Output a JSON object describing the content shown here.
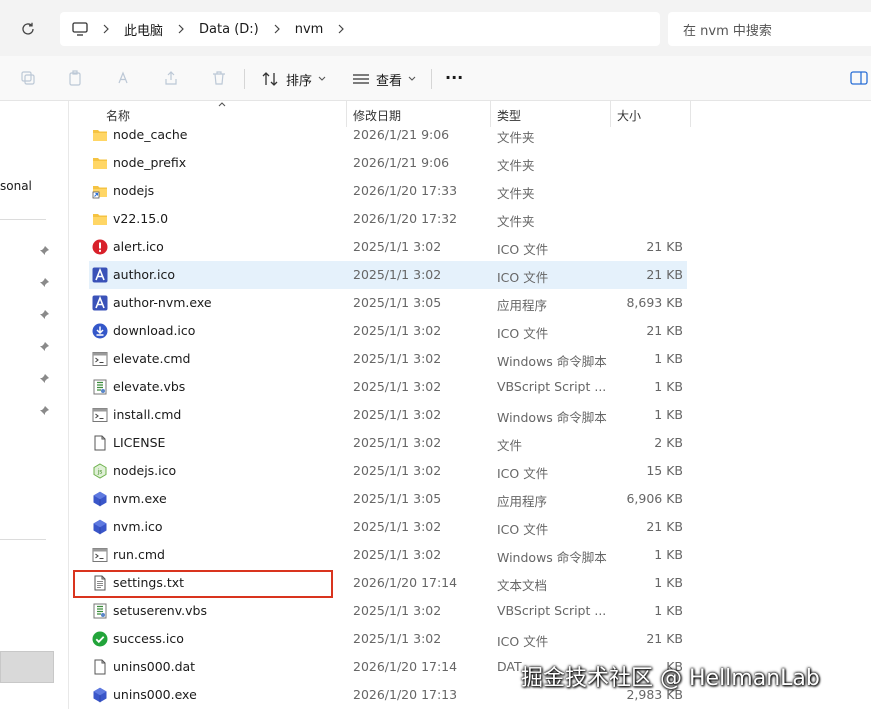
{
  "address": {
    "crumbs": [
      "此电脑",
      "Data (D:)",
      "nvm"
    ],
    "search_placeholder": "在 nvm 中搜索"
  },
  "toolbar": {
    "sort_label": "排序",
    "view_label": "查看",
    "more_label": "···"
  },
  "nav": {
    "partial_label": "sonal"
  },
  "columns": {
    "name": "名称",
    "date": "修改日期",
    "type": "类型",
    "size": "大小"
  },
  "files": [
    {
      "name": "node_cache",
      "date": "2026/1/21 9:06",
      "type": "文件夹",
      "size": "",
      "icon": "folder-icon"
    },
    {
      "name": "node_prefix",
      "date": "2026/1/21 9:06",
      "type": "文件夹",
      "size": "",
      "icon": "folder-icon"
    },
    {
      "name": "nodejs",
      "date": "2026/1/20 17:33",
      "type": "文件夹",
      "size": "",
      "icon": "folder-shortcut-icon"
    },
    {
      "name": "v22.15.0",
      "date": "2026/1/20 17:32",
      "type": "文件夹",
      "size": "",
      "icon": "folder-icon"
    },
    {
      "name": "alert.ico",
      "date": "2025/1/1 3:02",
      "type": "ICO 文件",
      "size": "21 KB",
      "icon": "alert-icon"
    },
    {
      "name": "author.ico",
      "date": "2025/1/1 3:02",
      "type": "ICO 文件",
      "size": "21 KB",
      "icon": "author-icon"
    },
    {
      "name": "author-nvm.exe",
      "date": "2025/1/1 3:05",
      "type": "应用程序",
      "size": "8,693 KB",
      "icon": "author-icon"
    },
    {
      "name": "download.ico",
      "date": "2025/1/1 3:02",
      "type": "ICO 文件",
      "size": "21 KB",
      "icon": "download-icon"
    },
    {
      "name": "elevate.cmd",
      "date": "2025/1/1 3:02",
      "type": "Windows 命令脚本",
      "size": "1 KB",
      "icon": "cmd-file-icon"
    },
    {
      "name": "elevate.vbs",
      "date": "2025/1/1 3:02",
      "type": "VBScript Script ...",
      "size": "1 KB",
      "icon": "vbs-file-icon"
    },
    {
      "name": "install.cmd",
      "date": "2025/1/1 3:02",
      "type": "Windows 命令脚本",
      "size": "1 KB",
      "icon": "cmd-file-icon"
    },
    {
      "name": "LICENSE",
      "date": "2025/1/1 3:02",
      "type": "文件",
      "size": "2 KB",
      "icon": "blank-file-icon"
    },
    {
      "name": "nodejs.ico",
      "date": "2025/1/1 3:02",
      "type": "ICO 文件",
      "size": "15 KB",
      "icon": "nodejs-icon"
    },
    {
      "name": "nvm.exe",
      "date": "2025/1/1 3:05",
      "type": "应用程序",
      "size": "6,906 KB",
      "icon": "nvm-icon"
    },
    {
      "name": "nvm.ico",
      "date": "2025/1/1 3:02",
      "type": "ICO 文件",
      "size": "21 KB",
      "icon": "nvm-icon"
    },
    {
      "name": "run.cmd",
      "date": "2025/1/1 3:02",
      "type": "Windows 命令脚本",
      "size": "1 KB",
      "icon": "cmd-file-icon"
    },
    {
      "name": "settings.txt",
      "date": "2026/1/20 17:14",
      "type": "文本文档",
      "size": "1 KB",
      "icon": "text-file-icon"
    },
    {
      "name": "setuserenv.vbs",
      "date": "2025/1/1 3:02",
      "type": "VBScript Script ...",
      "size": "1 KB",
      "icon": "vbs-file-icon"
    },
    {
      "name": "success.ico",
      "date": "2025/1/1 3:02",
      "type": "ICO 文件",
      "size": "21 KB",
      "icon": "success-icon"
    },
    {
      "name": "unins000.dat",
      "date": "2026/1/20 17:14",
      "type": "DAT",
      "size": "KB",
      "icon": "blank-file-icon"
    },
    {
      "name": "unins000.exe",
      "date": "2026/1/20 17:13",
      "type": "",
      "size": "2,983 KB",
      "icon": "nvm-icon"
    }
  ],
  "hovered_file": "author.ico",
  "highlighted_file": "settings.txt",
  "watermark": "掘金技术社区 @ HellmanLab",
  "colors": {
    "hover": "#e5f1fb",
    "highlight": "#d9341e",
    "folder": "#f5c342",
    "accent": "#3b5bd6"
  }
}
